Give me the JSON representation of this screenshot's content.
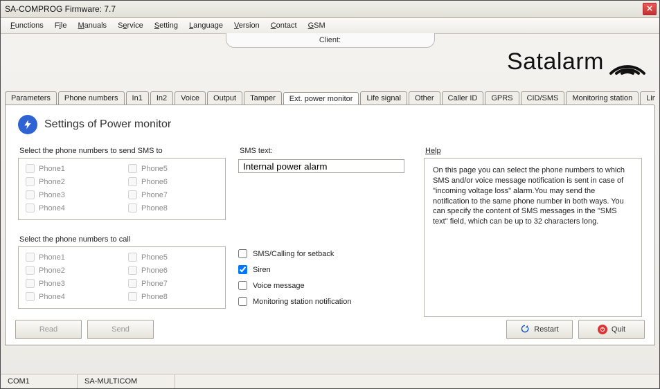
{
  "window": {
    "title": "SA-COMPROG Firmware: 7.7"
  },
  "menu": {
    "functions": "Functions",
    "file": "File",
    "manuals": "Manuals",
    "service": "Service",
    "setting": "Setting",
    "language": "Language",
    "version": "Version",
    "contact": "Contact",
    "gsm": "GSM"
  },
  "client_label": "Client:",
  "logo_text": "Satalarm",
  "tabs": {
    "parameters": "Parameters",
    "phone_numbers": "Phone numbers",
    "in1": "In1",
    "in2": "In2",
    "voice": "Voice",
    "output": "Output",
    "tamper": "Tamper",
    "ext_power_monitor": "Ext. power monitor",
    "life_signal": "Life signal",
    "other": "Other",
    "caller_id": "Caller ID",
    "gprs": "GPRS",
    "cidsms": "CID/SMS",
    "monitoring_station": "Monitoring station",
    "line_simulator": "Line simulator"
  },
  "page": {
    "title": "Settings of Power monitor",
    "sms_group_label": "Select the phone numbers to send SMS to",
    "call_group_label": "Select the phone numbers to call",
    "phones": {
      "p1": "Phone1",
      "p2": "Phone2",
      "p3": "Phone3",
      "p4": "Phone4",
      "p5": "Phone5",
      "p6": "Phone6",
      "p7": "Phone7",
      "p8": "Phone8"
    },
    "sms_text_label": "SMS text:",
    "sms_text_value": "Internal power alarm",
    "options": {
      "setback": "SMS/Calling for setback",
      "siren": "Siren",
      "voice_message": "Voice message",
      "monitoring_notification": "Monitoring station notification"
    },
    "help_label": "Help",
    "help_text": "On this page you can select the phone numbers to which SMS and/or voice message notification is sent in case of \"incoming voltage loss\" alarm.You may send the notification to the same phone number in both ways. You can specify the content of SMS messages in the \"SMS text\" field, which can be up to 32 characters long."
  },
  "buttons": {
    "read": "Read",
    "send": "Send",
    "restart": "Restart",
    "quit": "Quit"
  },
  "status": {
    "port": "COM1",
    "device": "SA-MULTICOM"
  }
}
